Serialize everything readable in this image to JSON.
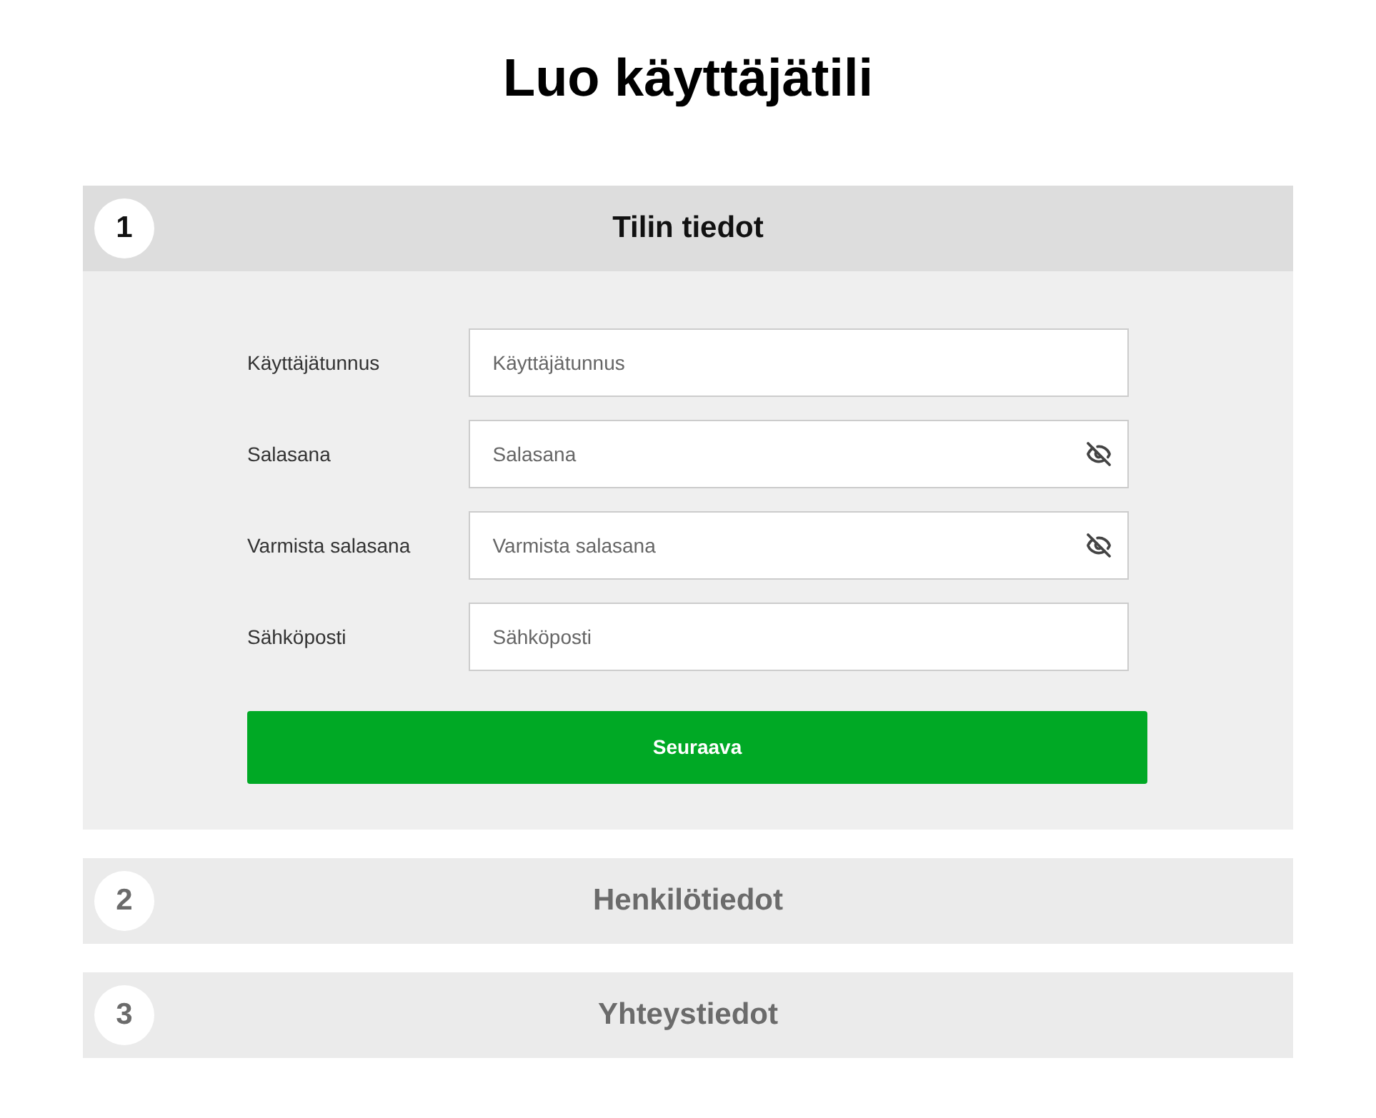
{
  "title": "Luo käyttäjätili",
  "steps": [
    {
      "number": "1",
      "title": "Tilin tiedot",
      "expanded": true,
      "fields": [
        {
          "label": "Käyttäjätunnus",
          "placeholder": "Käyttäjätunnus",
          "kind": "text"
        },
        {
          "label": "Salasana",
          "placeholder": "Salasana",
          "kind": "password"
        },
        {
          "label": "Varmista salasana",
          "placeholder": "Varmista salasana",
          "kind": "password"
        },
        {
          "label": "Sähköposti",
          "placeholder": "Sähköposti",
          "kind": "text"
        }
      ],
      "button": "Seuraava"
    },
    {
      "number": "2",
      "title": "Henkilötiedot",
      "expanded": false
    },
    {
      "number": "3",
      "title": "Yhteystiedot",
      "expanded": false
    }
  ]
}
